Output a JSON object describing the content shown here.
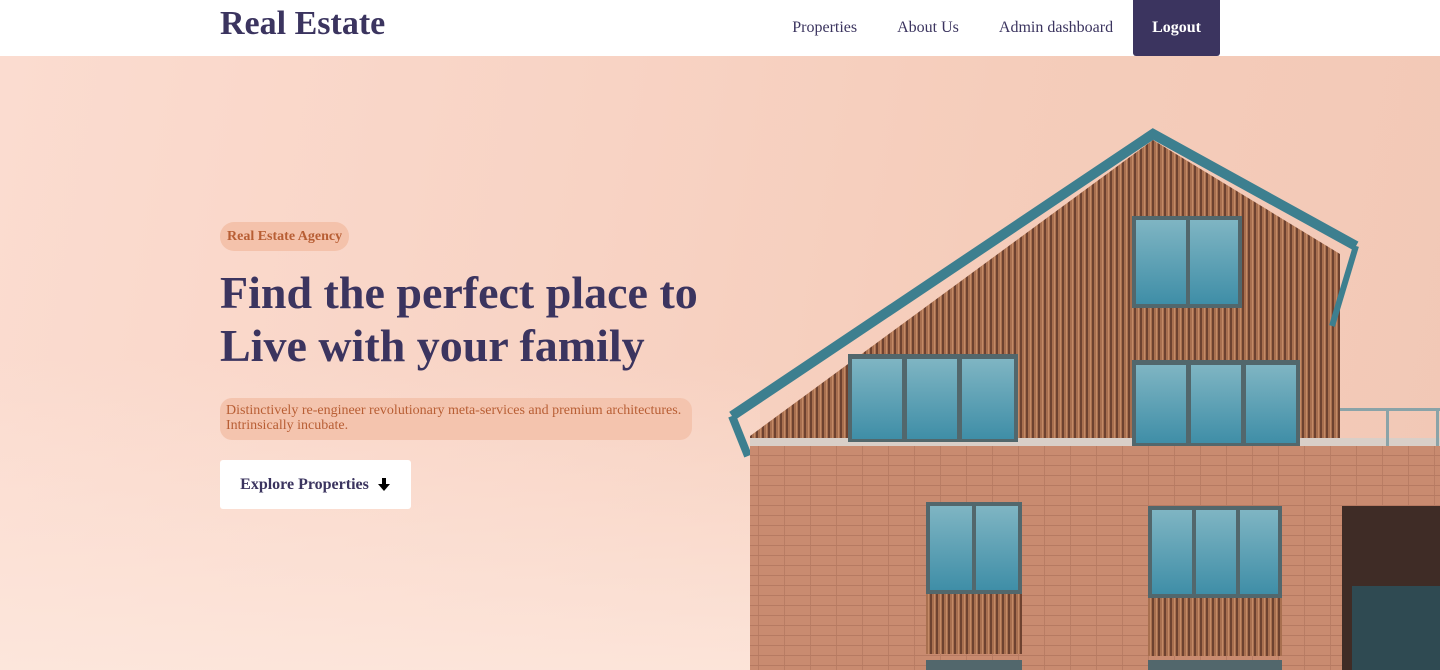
{
  "brand": "Real Estate",
  "nav": {
    "items": [
      {
        "label": "Properties"
      },
      {
        "label": "About Us"
      },
      {
        "label": "Admin dashboard"
      }
    ],
    "logout_label": "Logout"
  },
  "hero": {
    "tag": "Real Estate Agency",
    "headline_line1": "Find the perfect place to",
    "headline_line2": "Live with your family",
    "description_line1": "Distinctively re-engineer revolutionary meta-services and premium architectures.",
    "description_line2": "Intrinsically incubate.",
    "cta_label": "Explore Properties",
    "cta_icon": "arrow-down-icon"
  },
  "colors": {
    "primary": "#3b345f",
    "accent_text": "#b85e34",
    "tag_bg": "#f4c2ab",
    "hero_bg": "#f8d3c4"
  }
}
